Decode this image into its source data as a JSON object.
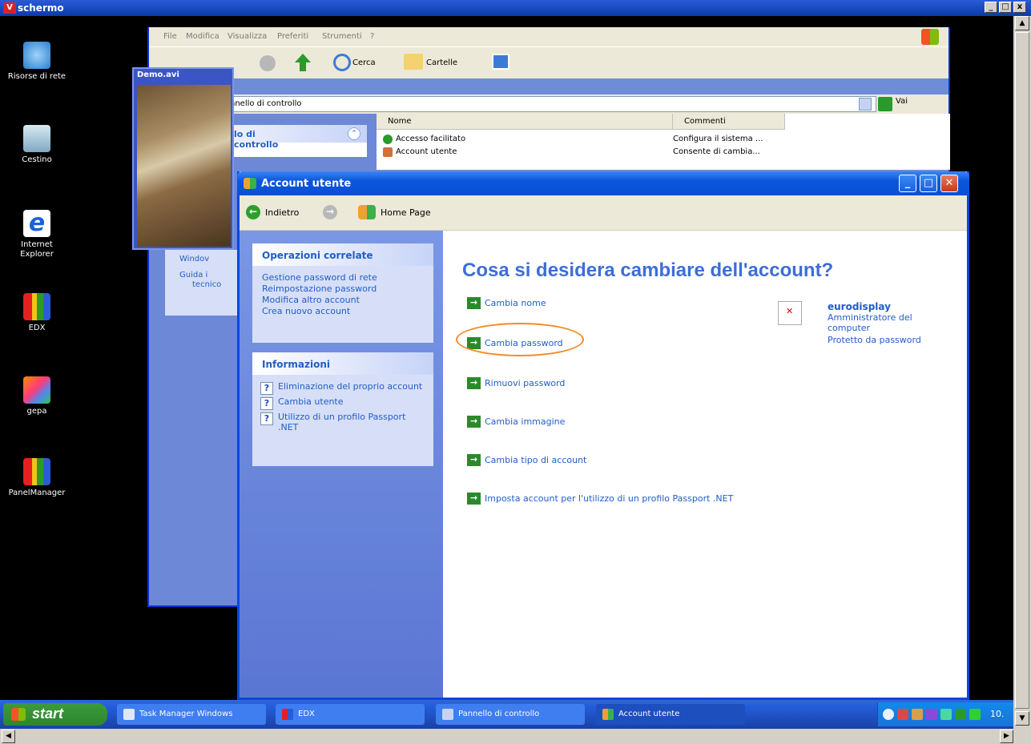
{
  "outer": {
    "title": "schermo",
    "badge": "V"
  },
  "desktop": [
    {
      "label": "Risorse di rete"
    },
    {
      "label": "Cestino"
    },
    {
      "label": "Internet Explorer"
    },
    {
      "label": "EDX"
    },
    {
      "label": "gepa"
    },
    {
      "label": "PanelManager"
    }
  ],
  "controlpanel": {
    "menu": [
      "File",
      "Modifica",
      "Visualizza",
      "Preferiti",
      "Strumenti",
      "?"
    ],
    "toolbar": {
      "search": "Cerca",
      "folders": "Cartelle"
    },
    "address": "Pannello di controllo",
    "address_visible": "nnello di controllo",
    "go": "Vai",
    "sidepanel_title": "lo di controllo",
    "columns": [
      "Nome",
      "Commenti"
    ],
    "rows": [
      {
        "name": "Accesso facilitato",
        "comment": "Configura il sistema ..."
      },
      {
        "name": "Account utente",
        "comment": "Consente di cambia..."
      }
    ],
    "side_items": [
      "Windov",
      "Guida i",
      "tecnico"
    ]
  },
  "video": {
    "title": "Demo.avi"
  },
  "account_window": {
    "title": "Account utente",
    "nav": {
      "back": "Indietro",
      "home": "Home Page"
    },
    "related": {
      "header": "Operazioni correlate",
      "links": [
        "Gestione password di rete",
        "Reimpostazione password",
        "Modifica altro account",
        "Crea nuovo account"
      ]
    },
    "info": {
      "header": "Informazioni",
      "items": [
        "Eliminazione del proprio account",
        "Cambia utente",
        "Utilizzo di un profilo Passport .NET"
      ]
    },
    "heading": "Cosa si desidera cambiare dell'account?",
    "tasks": [
      "Cambia nome",
      "Cambia password",
      "Rimuovi password",
      "Cambia immagine",
      "Cambia tipo di account",
      "Imposta account per l'utilizzo di un profilo Passport .NET"
    ],
    "account": {
      "name": "eurodisplay",
      "role": "Amministratore del computer",
      "status": "Protetto da password"
    }
  },
  "taskbar": {
    "start": "start",
    "items": [
      "Task Manager Windows",
      "EDX",
      "Pannello di controllo",
      "Account utente"
    ],
    "clock": "10."
  },
  "colors": {
    "xp_blue": "#0a56dc",
    "accent_orange": "#f28c28",
    "link_blue": "#215dc6"
  }
}
